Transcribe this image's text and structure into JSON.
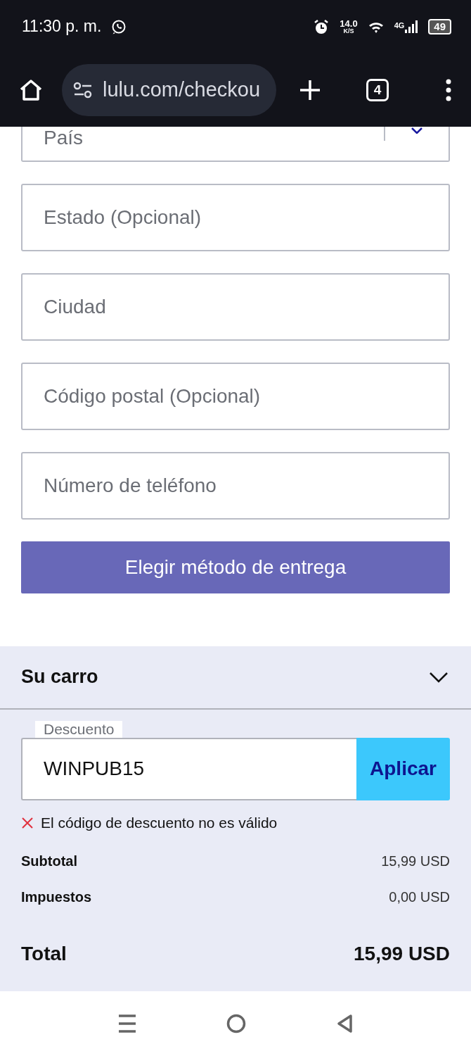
{
  "status_bar": {
    "time": "11:30 p. m.",
    "net_speed": "14.0",
    "net_unit": "K/S",
    "network": "4G",
    "battery": "49"
  },
  "browser": {
    "url": "lulu.com/checkou",
    "tab_count": "4"
  },
  "form": {
    "fields": [
      {
        "kind": "select",
        "placeholder": "País"
      },
      {
        "kind": "text",
        "placeholder": "Estado (Opcional)"
      },
      {
        "kind": "text",
        "placeholder": "Ciudad"
      },
      {
        "kind": "text",
        "placeholder": "Código postal (Opcional)"
      },
      {
        "kind": "text",
        "placeholder": "Número de teléfono"
      }
    ],
    "submit": "Elegir método de entrega"
  },
  "cart": {
    "title": "Su carro",
    "discount": {
      "label": "Descuento",
      "value": "WINPUB15",
      "button": "Aplicar",
      "error": "El código de descuento no es válido"
    },
    "lines": [
      {
        "label": "Subtotal",
        "amount": "15,99 USD"
      },
      {
        "label": "Impuestos",
        "amount": "0,00 USD"
      }
    ],
    "total": {
      "label": "Total",
      "amount": "15,99 USD"
    }
  }
}
